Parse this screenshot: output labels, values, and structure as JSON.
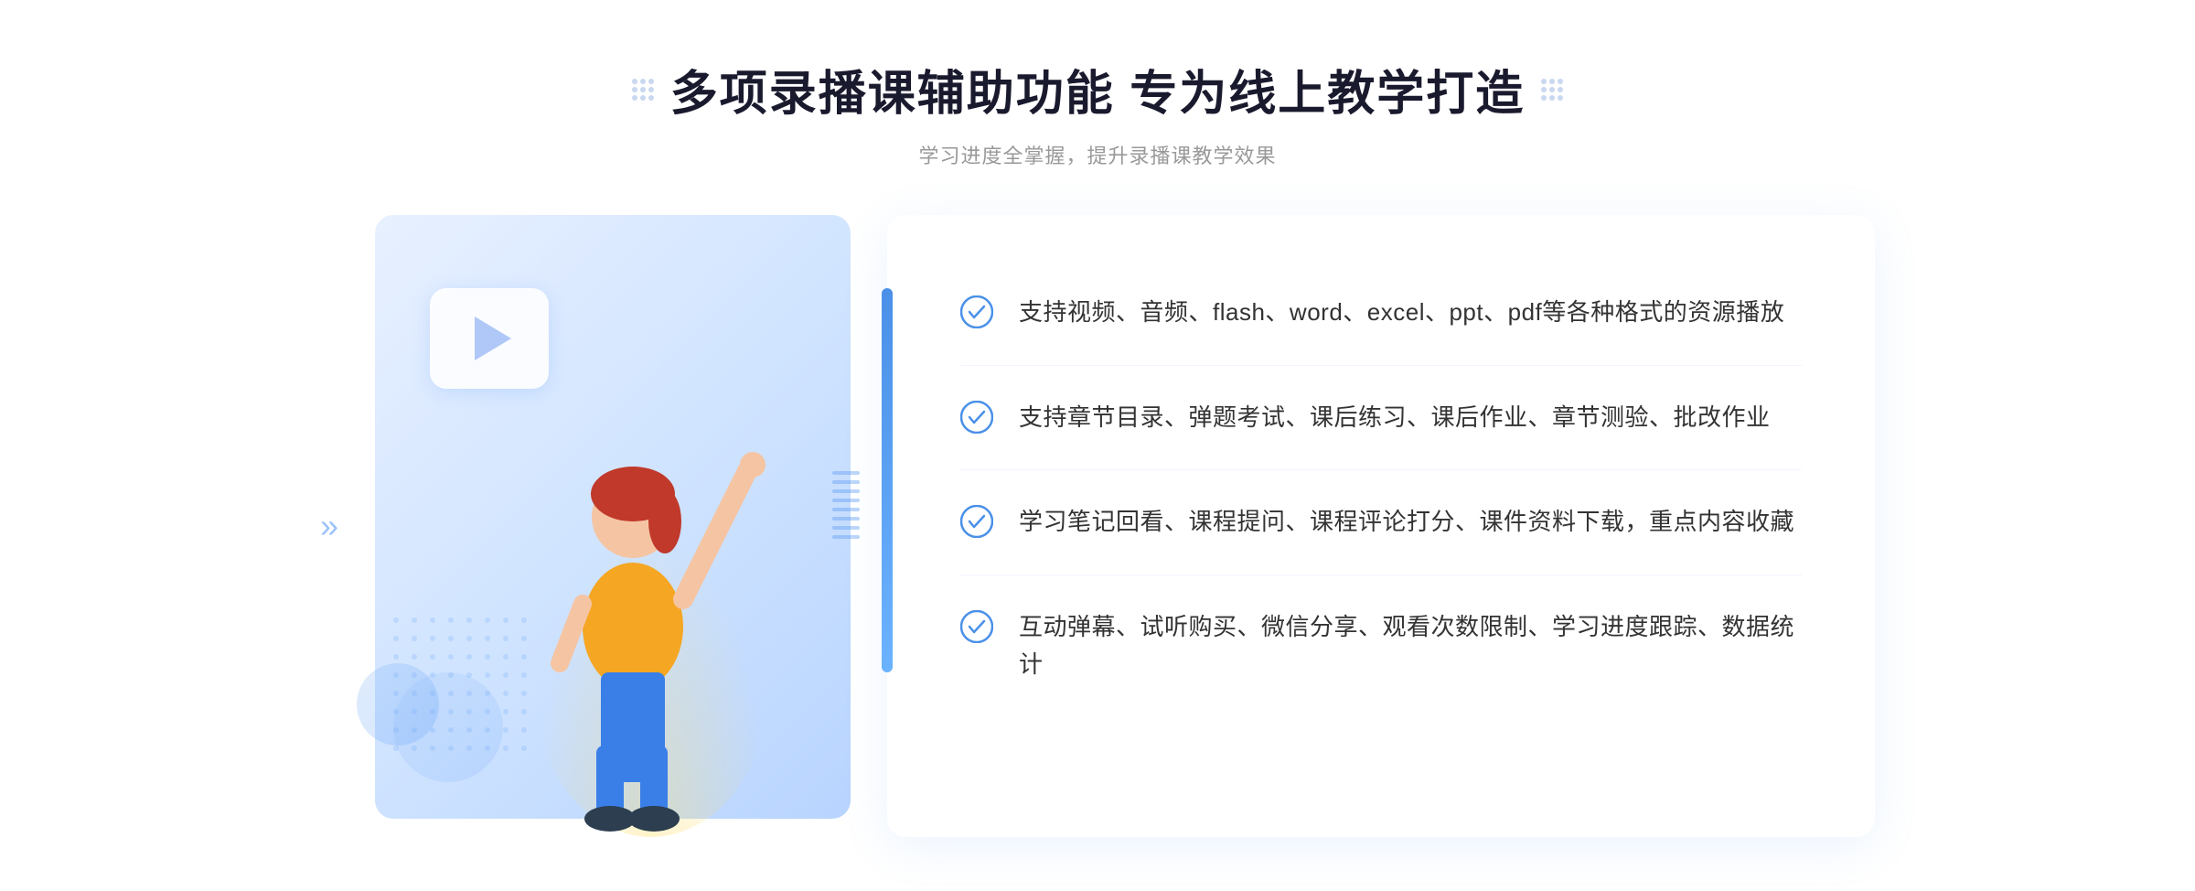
{
  "header": {
    "title": "多项录播课辅助功能 专为线上教学打造",
    "subtitle": "学习进度全掌握，提升录播课教学效果"
  },
  "features": [
    {
      "id": "feature-1",
      "text": "支持视频、音频、flash、word、excel、ppt、pdf等各种格式的资源播放"
    },
    {
      "id": "feature-2",
      "text": "支持章节目录、弹题考试、课后练习、课后作业、章节测验、批改作业"
    },
    {
      "id": "feature-3",
      "text": "学习笔记回看、课程提问、课程评论打分、课件资料下载，重点内容收藏"
    },
    {
      "id": "feature-4",
      "text": "互动弹幕、试听购买、微信分享、观看次数限制、学习进度跟踪、数据统计"
    }
  ],
  "decorations": {
    "chevron": "»",
    "check_color": "#4a90e8",
    "accent_color": "#4a90e8"
  }
}
